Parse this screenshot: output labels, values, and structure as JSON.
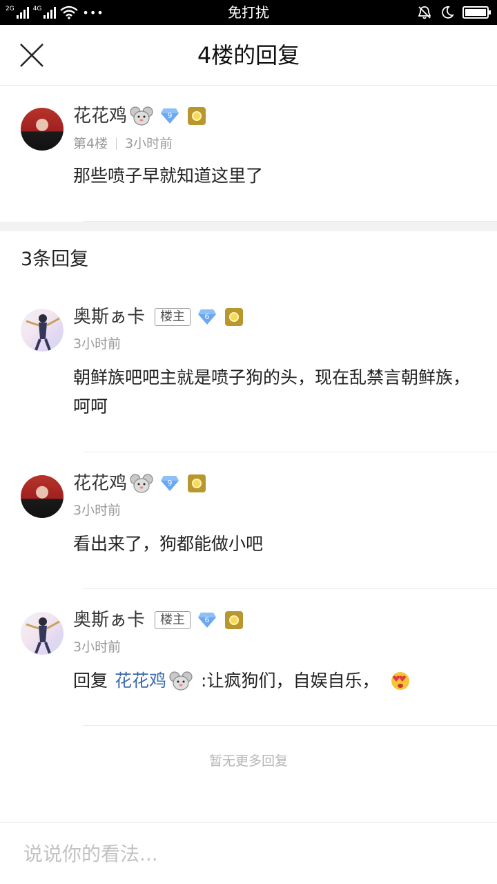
{
  "status_bar": {
    "sim1": "2G",
    "sim2": "4G",
    "more": "•••",
    "mode": "免打扰"
  },
  "header": {
    "title": "4楼的回复"
  },
  "main_post": {
    "username": "花花鸡",
    "level": "9",
    "floor": "第4楼",
    "time": "3小时前",
    "content": "那些喷子早就知道这里了"
  },
  "replies_header": "3条回复",
  "replies": [
    {
      "username": "奥斯ぁ卡",
      "owner_tag": "楼主",
      "level": "6",
      "time": "3小时前",
      "content": "朝鲜族吧吧主就是喷子狗的头，现在乱禁言朝鲜族，呵呵"
    },
    {
      "username": "花花鸡",
      "level": "9",
      "time": "3小时前",
      "content": "看出来了，狗都能做小吧"
    },
    {
      "username": "奥斯ぁ卡",
      "owner_tag": "楼主",
      "level": "6",
      "time": "3小时前",
      "reply_prefix": "回复",
      "reply_to": "花花鸡",
      "content": ":让疯狗们，自娱自乐，"
    }
  ],
  "no_more": "暂无更多回复",
  "comment_input": {
    "placeholder": "说说你的看法..."
  },
  "colors": {
    "link": "#3a6bb0",
    "badge_blue": "#5b9cf0",
    "medal": "#b9972e"
  }
}
